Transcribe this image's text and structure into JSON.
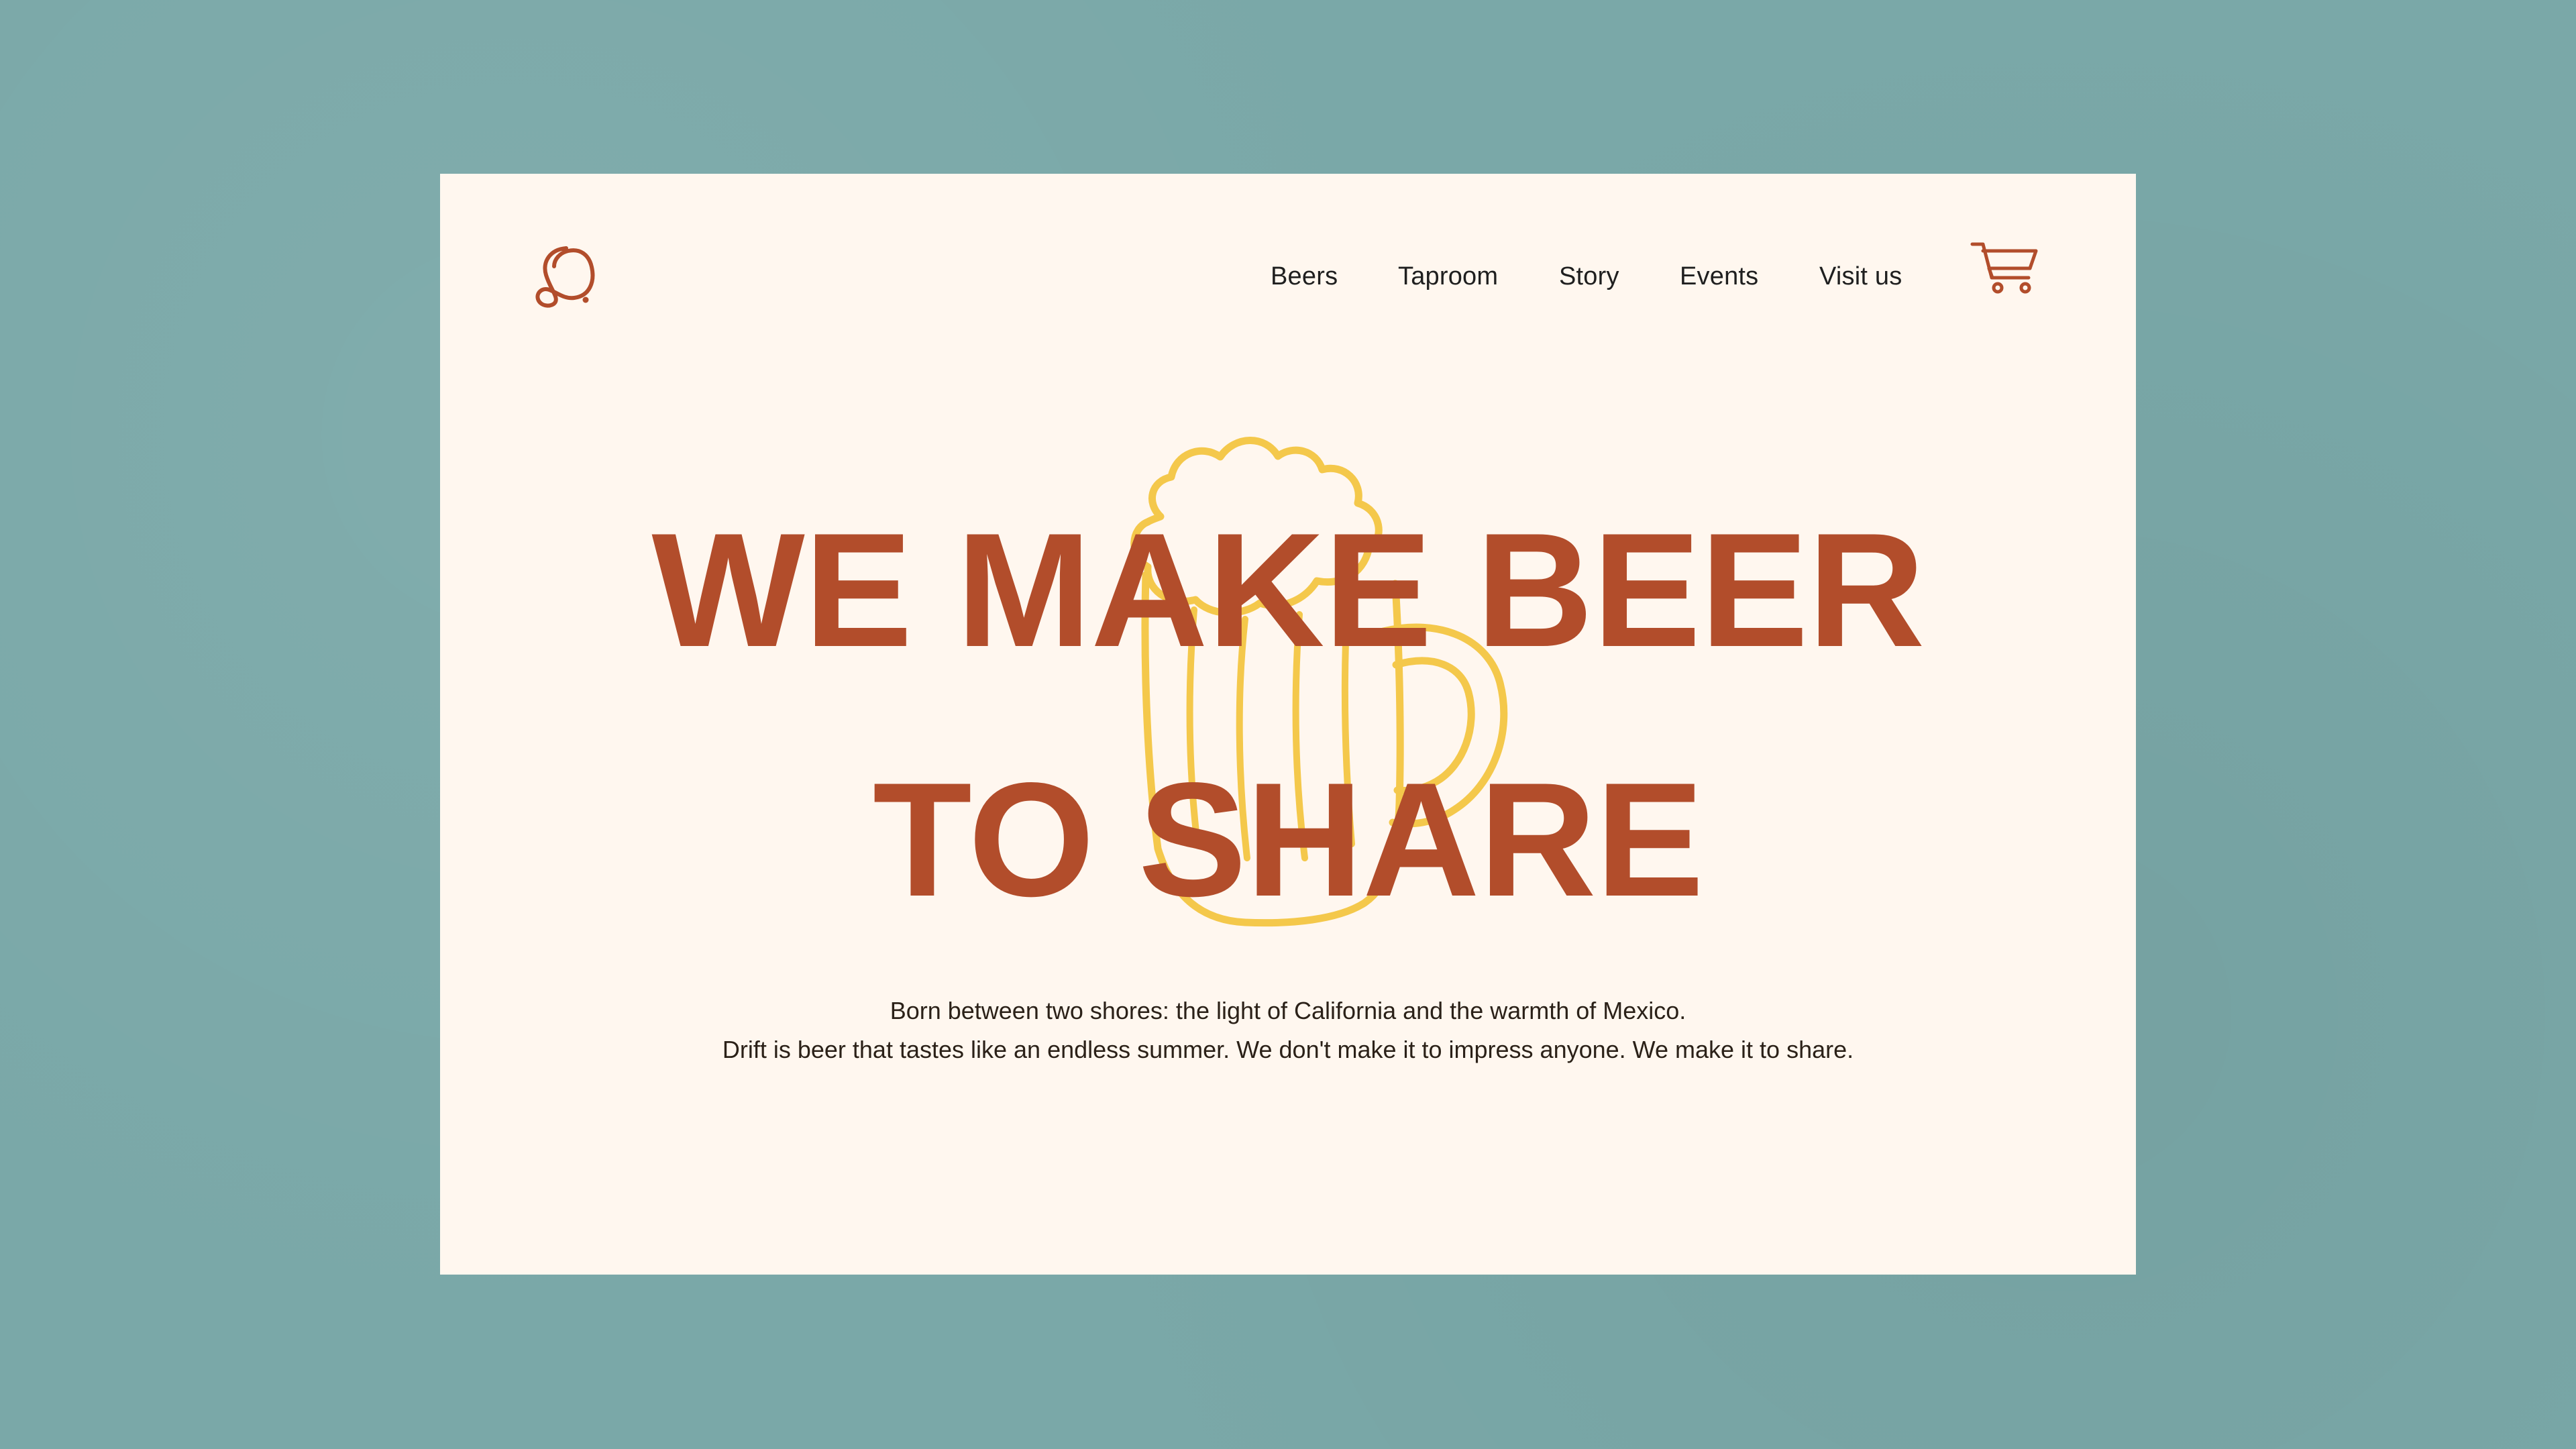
{
  "nav": {
    "items": [
      {
        "label": "Beers"
      },
      {
        "label": "Taproom"
      },
      {
        "label": "Story"
      },
      {
        "label": "Events"
      },
      {
        "label": "Visit us"
      }
    ]
  },
  "hero": {
    "headline_line1": "WE MAKE BEER",
    "headline_line2": "TO SHARE",
    "paragraph_line1": "Born between two shores: the light of California and the warmth of Mexico.",
    "paragraph_line2": "Drift is beer that tastes like an endless summer. We don't make it to impress anyone. We make it to share."
  },
  "icons": {
    "logo": "script-d-logo-icon",
    "cart": "shopping-cart-icon",
    "illustration": "beer-mug-icon"
  },
  "colors": {
    "page_background": "#7aa8a8",
    "card_background": "#fff7ef",
    "accent": "#b24d2b",
    "illustration": "#f4c84b",
    "text": "#1f1f1f"
  }
}
